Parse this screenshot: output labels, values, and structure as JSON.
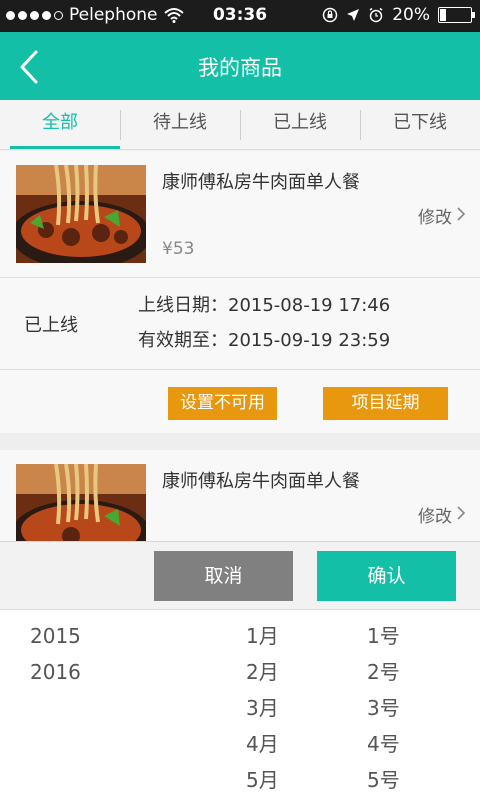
{
  "status_bar": {
    "carrier": "Pelephone",
    "time": "03:36",
    "battery": "20%",
    "battery_level": 0.2
  },
  "nav": {
    "title": "我的商品",
    "back_icon": "chevron-left-icon"
  },
  "tabs": [
    {
      "label": "全部",
      "active": true
    },
    {
      "label": "待上线",
      "active": false
    },
    {
      "label": "已上线",
      "active": false
    },
    {
      "label": "已下线",
      "active": false
    }
  ],
  "items": [
    {
      "name": "康师傅私房牛肉面单人餐",
      "edit_label": "修改",
      "price": "¥53",
      "status": "已上线",
      "online_date_label": "上线日期：",
      "online_date": "2015-08-19 17:46",
      "valid_until_label": "有效期至：",
      "valid_until": "2015-09-19 23:59",
      "action_disable": "设置不可用",
      "action_extend": "项目延期"
    },
    {
      "name": "康师傅私房牛肉面单人餐",
      "edit_label": "修改"
    }
  ],
  "picker": {
    "cancel_label": "取消",
    "confirm_label": "确认",
    "years": [
      "2015",
      "2016"
    ],
    "months": [
      "1月",
      "2月",
      "3月",
      "4月",
      "5月"
    ],
    "days": [
      "1号",
      "2号",
      "3号",
      "4号",
      "5号"
    ]
  },
  "colors": {
    "accent": "#13bfa6",
    "action_orange": "#e8980f",
    "cancel_gray": "#808080"
  }
}
